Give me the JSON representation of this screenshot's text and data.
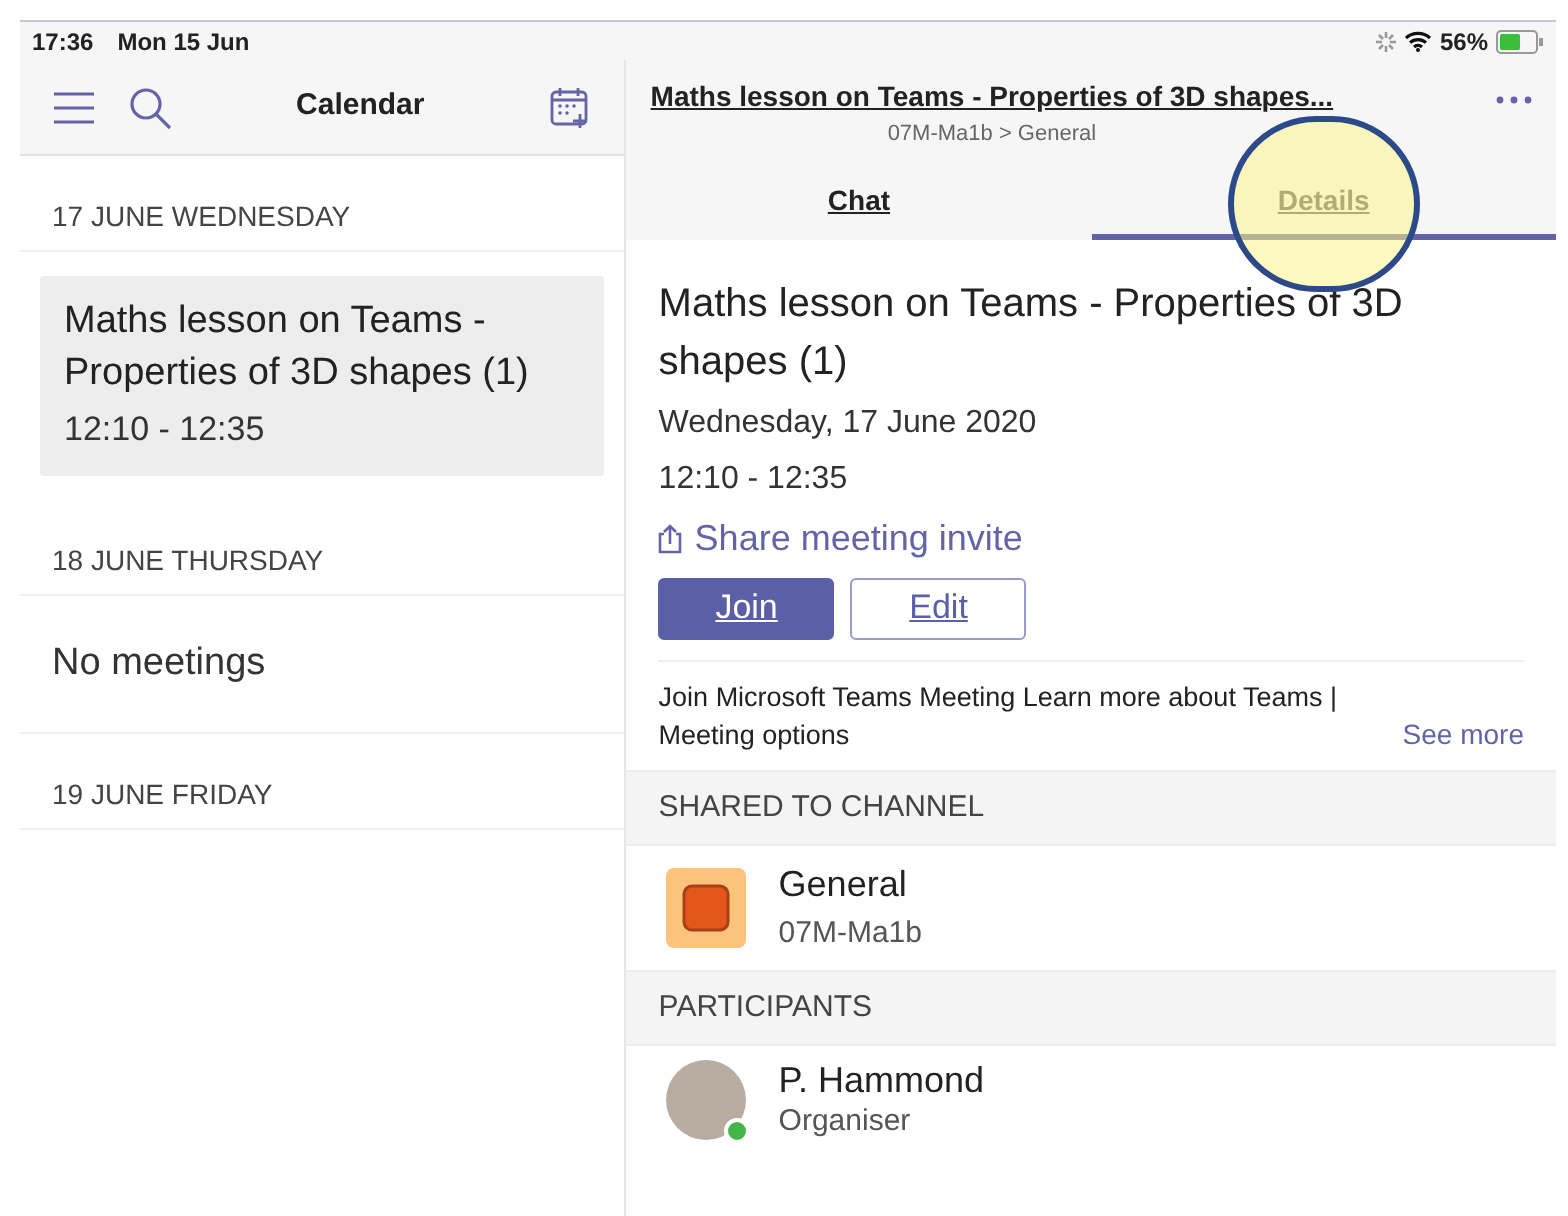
{
  "status_bar": {
    "time": "17:36",
    "date": "Mon 15 Jun",
    "battery": "56%"
  },
  "calendar": {
    "title": "Calendar",
    "days": [
      {
        "heading": "17 JUNE  WEDNESDAY",
        "meetings": [
          {
            "title": "Maths lesson on Teams - Properties of 3D shapes (1)",
            "time": "12:10 - 12:35",
            "selected": true
          }
        ]
      },
      {
        "heading": "18 JUNE  THURSDAY",
        "empty_text": "No meetings"
      },
      {
        "heading": "19 JUNE  FRIDAY"
      }
    ]
  },
  "meeting": {
    "header_title": "Maths lesson on Teams - Properties of 3D shapes...",
    "breadcrumb": "07M-Ma1b > General",
    "tabs": [
      {
        "label": "Chat",
        "selected": false
      },
      {
        "label": "Details",
        "selected": true
      }
    ],
    "title": "Maths lesson on Teams - Properties of 3D shapes (1)",
    "date": "Wednesday, 17 June 2020",
    "time": "12:10 - 12:35",
    "share_link": "Share meeting invite",
    "buttons": [
      {
        "label": "Join",
        "kind": "primary"
      },
      {
        "label": "Edit",
        "kind": "secondary"
      }
    ],
    "description": "Join Microsoft Teams Meeting Learn more about Teams | Meeting options",
    "see_more": "See more",
    "channel_heading": "SHARED TO CHANNEL",
    "channel": {
      "name": "General",
      "team": "07M-Ma1b"
    },
    "participants_heading": "PARTICIPANTS",
    "participants": [
      {
        "name": "P. Hammond",
        "role": "Organiser"
      }
    ]
  }
}
